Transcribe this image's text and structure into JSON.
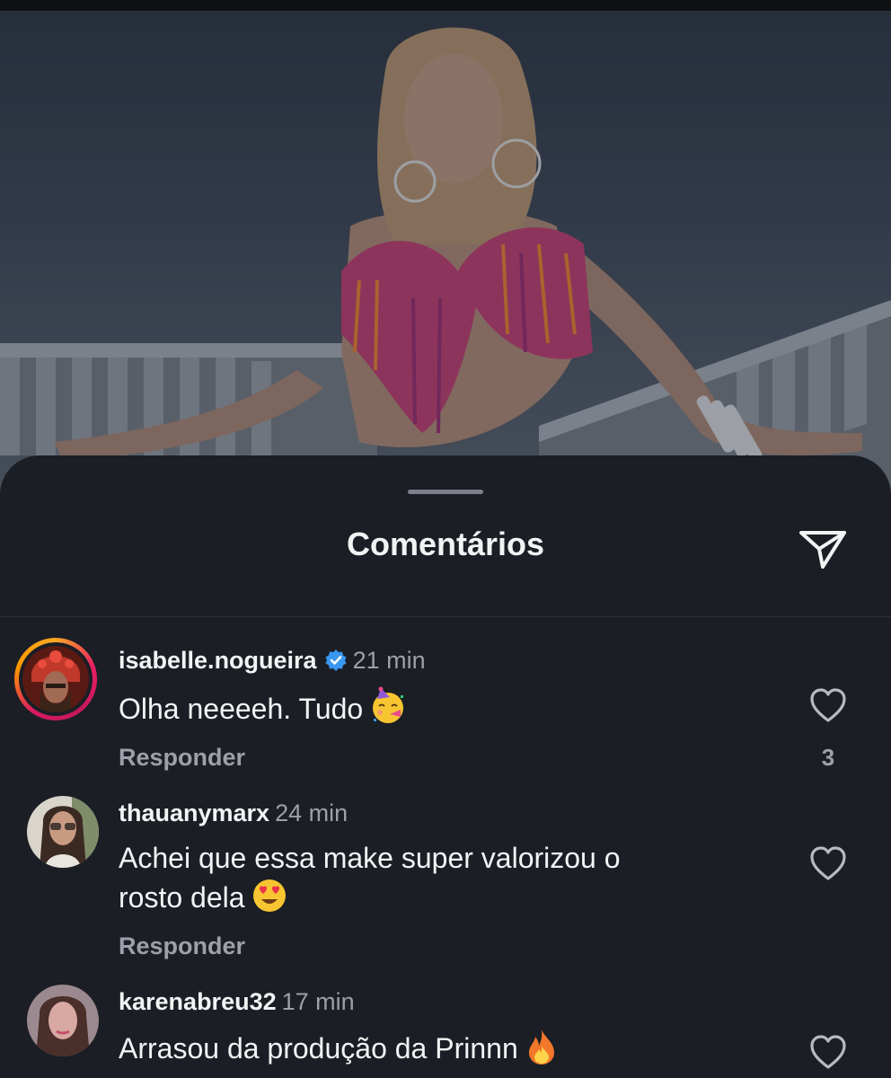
{
  "sheet": {
    "title": "Comentários"
  },
  "icons": {
    "share": "paper-plane-icon",
    "like": "heart-icon",
    "verified": "verified-badge-icon"
  },
  "colors": {
    "sheet_bg": "#1b1e24",
    "text_primary": "#f2f3f5",
    "text_secondary": "#9ba0a9",
    "verified_blue": "#3897f0"
  },
  "comments": [
    {
      "username": "isabelle.nogueira",
      "verified": true,
      "time": "21 min",
      "text": "Olha neeeeh. Tudo",
      "emoji": "partying-face",
      "reply_label": "Responder",
      "likes": "3",
      "has_story_ring": true
    },
    {
      "username": "thauanymarx",
      "verified": false,
      "time": "24 min",
      "text_line1": "Achei que essa make super valorizou o",
      "text_line2": "rosto dela",
      "emoji": "heart-eyes-face",
      "reply_label": "Responder"
    },
    {
      "username": "karenabreu32",
      "verified": false,
      "time": "17 min",
      "text": "Arrasou da produção da Prinnn",
      "emoji": "fire"
    }
  ]
}
